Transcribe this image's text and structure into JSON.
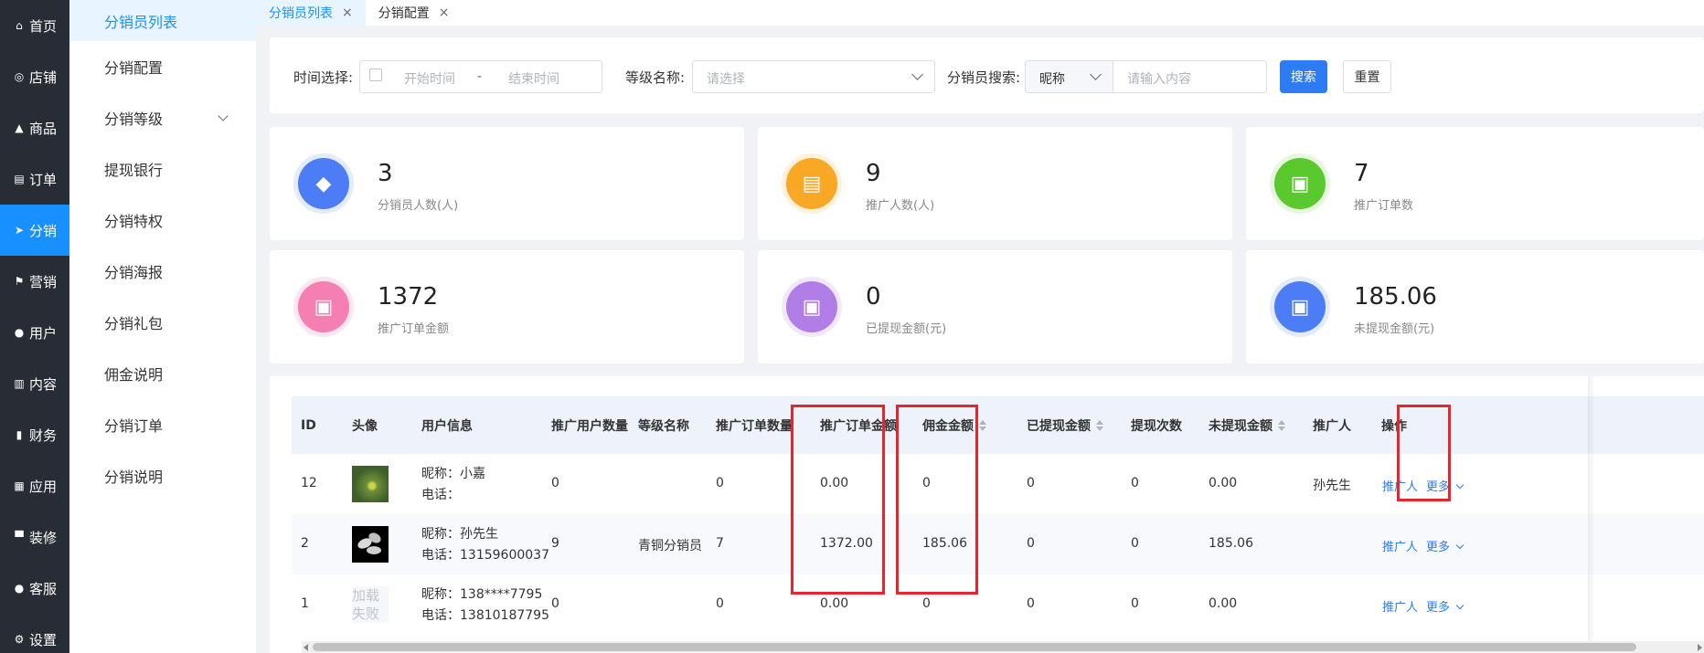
{
  "nav": [
    {
      "label": "首页",
      "icon": "home-icon",
      "glyph": "⌂"
    },
    {
      "label": "店铺",
      "icon": "store-icon",
      "glyph": "◎"
    },
    {
      "label": "商品",
      "icon": "goods-icon",
      "glyph": "▲"
    },
    {
      "label": "订单",
      "icon": "order-icon",
      "glyph": "▤"
    },
    {
      "label": "分销",
      "icon": "share-icon",
      "glyph": "➤"
    },
    {
      "label": "营销",
      "icon": "flag-icon",
      "glyph": "⚑"
    },
    {
      "label": "用户",
      "icon": "user-icon",
      "glyph": "●"
    },
    {
      "label": "内容",
      "icon": "content-icon",
      "glyph": "▥"
    },
    {
      "label": "财务",
      "icon": "finance-icon",
      "glyph": "▮"
    },
    {
      "label": "应用",
      "icon": "apps-icon",
      "glyph": "▦"
    },
    {
      "label": "装修",
      "icon": "decoration-icon",
      "glyph": "▀"
    },
    {
      "label": "客服",
      "icon": "service-icon",
      "glyph": "●"
    },
    {
      "label": "设置",
      "icon": "settings-icon",
      "glyph": "⚙"
    }
  ],
  "submenu": [
    "分销员列表",
    "分销配置",
    "分销等级",
    "提现银行",
    "分销特权",
    "分销海报",
    "分销礼包",
    "佣金说明",
    "分销订单",
    "分销说明"
  ],
  "tabs": [
    {
      "label": "分销员列表",
      "close": "×"
    },
    {
      "label": "分销配置",
      "close": "×"
    }
  ],
  "filter": {
    "time_label": "时间选择:",
    "start_placeholder": "开始时间",
    "sep": "-",
    "end_placeholder": "结束时间",
    "level_label": "等级名称:",
    "level_placeholder": "请选择",
    "search_label": "分销员搜索:",
    "search_type": "昵称",
    "search_placeholder": "请输入内容",
    "search_btn": "搜索",
    "reset_btn": "重置"
  },
  "stats": [
    {
      "value": "3",
      "label": "分销员人数(人)",
      "color": "#4c7df6",
      "ring": "#e3ebff",
      "icon": "bag-icon",
      "glyph": "◆"
    },
    {
      "value": "9",
      "label": "推广人数(人)",
      "color": "#f8a825",
      "ring": "#fff1db",
      "icon": "clipboard-icon",
      "glyph": "▤"
    },
    {
      "value": "7",
      "label": "推广订单数",
      "color": "#5ac92d",
      "ring": "#e7f7df",
      "icon": "briefcase-icon",
      "glyph": "▣"
    },
    {
      "value": "1372",
      "label": "推广订单金额",
      "color": "#f57fb1",
      "ring": "#fde6f0",
      "icon": "briefcase-icon",
      "glyph": "▣"
    },
    {
      "value": "0",
      "label": "已提现金额(元)",
      "color": "#b07ee6",
      "ring": "#f1e8fb",
      "icon": "briefcase-icon",
      "glyph": "▣"
    },
    {
      "value": "185.06",
      "label": "未提现金额(元)",
      "color": "#4c7df6",
      "ring": "#e3ebff",
      "icon": "briefcase-icon",
      "glyph": "▣"
    }
  ],
  "table": {
    "headers": [
      "ID",
      "头像",
      "用户信息",
      "推广用户数量",
      "等级名称",
      "推广订单数量",
      "推广订单金额",
      "佣金金额",
      "已提现金额",
      "提现次数",
      "未提现金额",
      "推广人",
      "操作"
    ],
    "rows": [
      {
        "id": "12",
        "nick": "昵称：小嘉",
        "phone": "电话：",
        "users": "0",
        "level": "",
        "orders": "0",
        "order_amount": "0.00",
        "commission": "0",
        "withdrawn": "0",
        "withdraw_times": "0",
        "unwithdrawn": "0.00",
        "promoter": "孙先生",
        "act1": "推广人",
        "act2": "更多",
        "avatar_text": ""
      },
      {
        "id": "2",
        "nick": "昵称：孙先生",
        "phone": "电话：13159600037",
        "users": "9",
        "level": "青铜分销员",
        "orders": "7",
        "order_amount": "1372.00",
        "commission": "185.06",
        "withdrawn": "0",
        "withdraw_times": "0",
        "unwithdrawn": "185.06",
        "promoter": "",
        "act1": "推广人",
        "act2": "更多",
        "avatar_text": ""
      },
      {
        "id": "1",
        "nick": "昵称：138****7795",
        "phone": "电话：13810187795",
        "users": "0",
        "level": "",
        "orders": "0",
        "order_amount": "0.00",
        "commission": "0",
        "withdrawn": "0",
        "withdraw_times": "0",
        "unwithdrawn": "0.00",
        "promoter": "",
        "act1": "推广人",
        "act2": "更多",
        "avatar_text": "加载失败"
      }
    ]
  }
}
